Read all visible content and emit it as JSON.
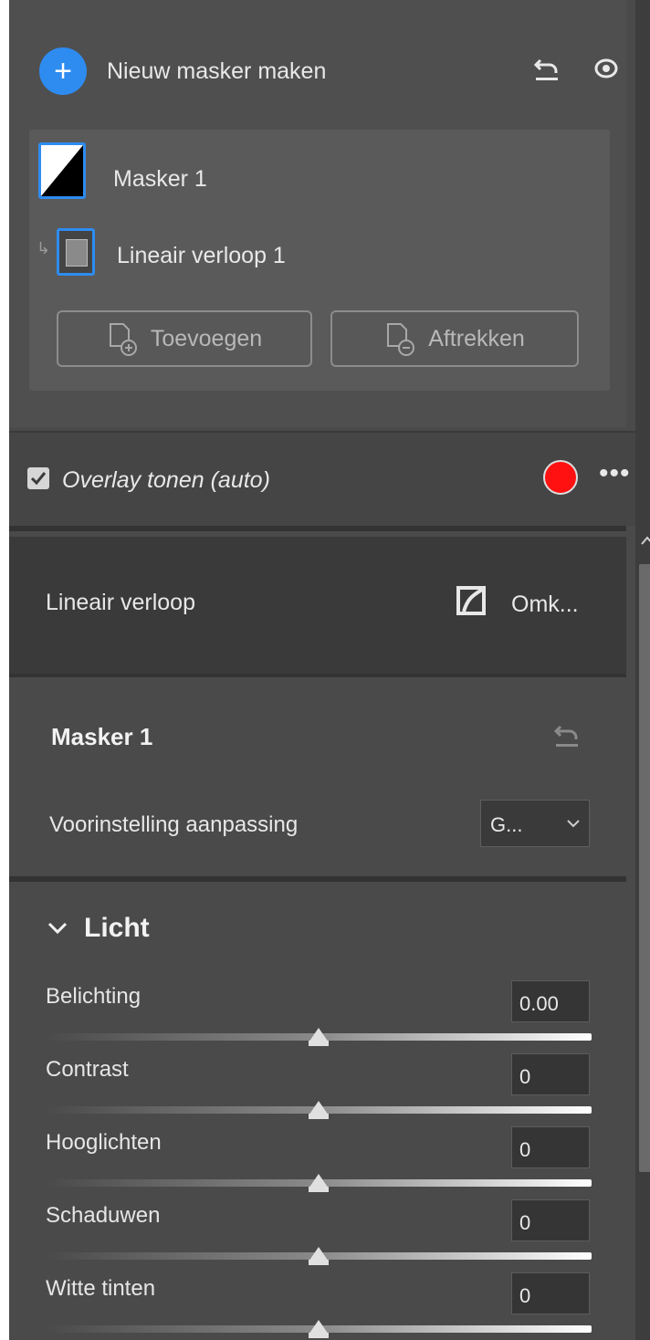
{
  "masks": {
    "new_mask_label": "Nieuw masker maken",
    "mask_name": "Masker 1",
    "component_name": "Lineair verloop 1",
    "add_label": "Toevoegen",
    "subtract_label": "Aftrekken"
  },
  "overlay": {
    "label": "Overlay tonen (auto)",
    "checked": true,
    "color": "#ff1111",
    "more_label": "•••"
  },
  "linear": {
    "label": "Lineair verloop",
    "invert_label": "Omk..."
  },
  "mask_settings": {
    "title": "Masker 1",
    "preset_label": "Voorinstelling aanpassing",
    "preset_value": "G..."
  },
  "light": {
    "title": "Licht",
    "sliders": [
      {
        "label": "Belichting",
        "value": "0.00",
        "position": 0.5
      },
      {
        "label": "Contrast",
        "value": "0",
        "position": 0.5
      },
      {
        "label": "Hooglichten",
        "value": "0",
        "position": 0.5
      },
      {
        "label": "Schaduwen",
        "value": "0",
        "position": 0.5
      },
      {
        "label": "Witte tinten",
        "value": "0",
        "position": 0.5
      }
    ]
  },
  "colors": {
    "accent": "#2e8cf0",
    "panel_bg": "#4a4a4a"
  }
}
